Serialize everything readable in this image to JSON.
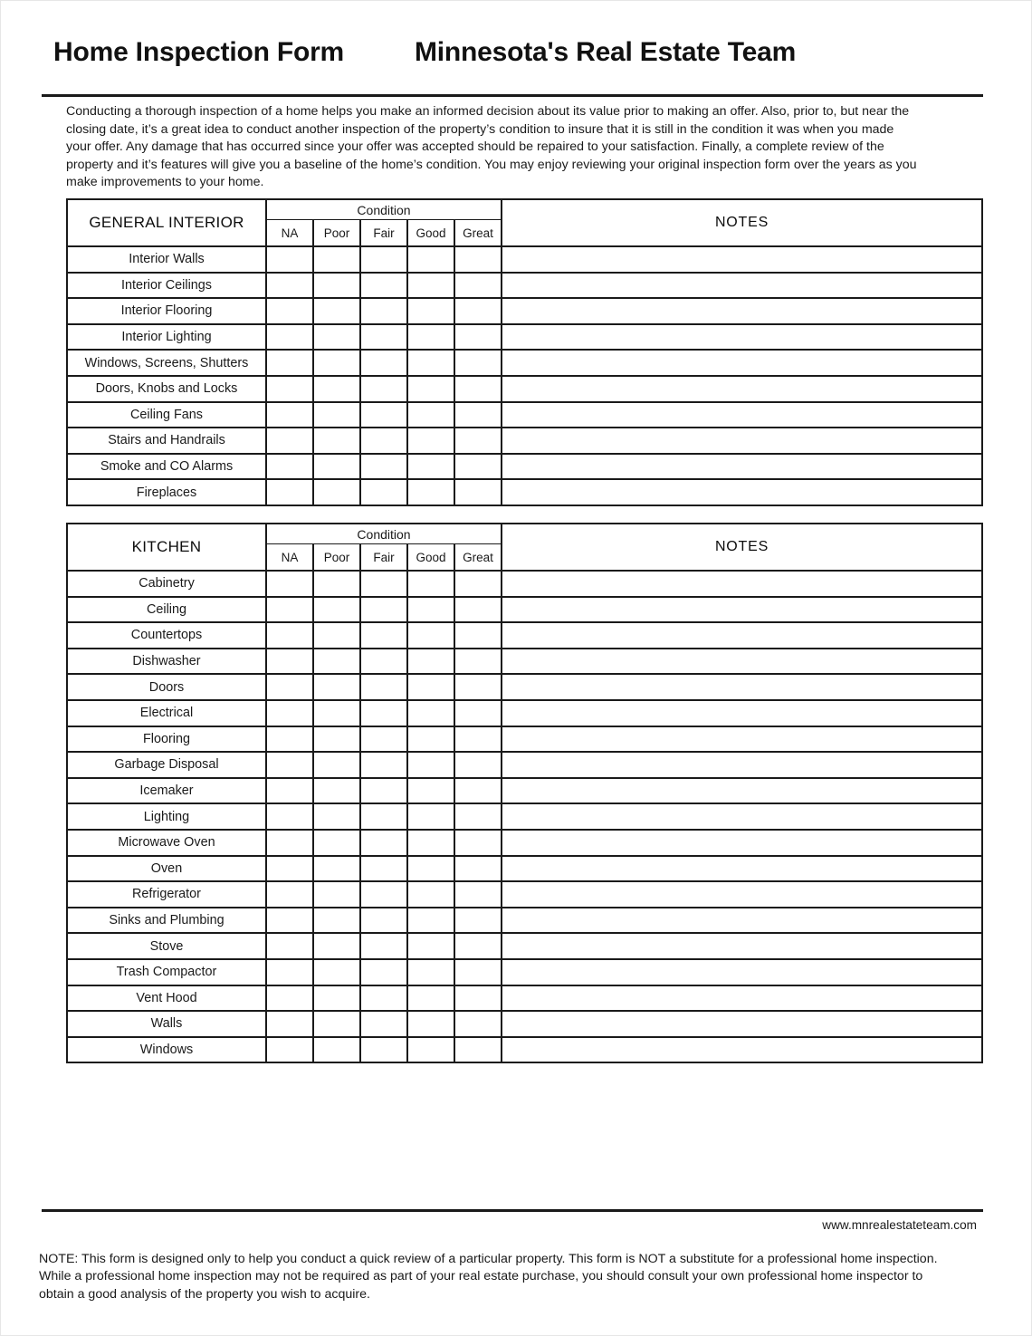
{
  "header": {
    "form_title": "Home Inspection Form",
    "brand_title": "Minnesota's Real Estate Team"
  },
  "intro": {
    "paragraph": "Conducting a thorough inspection of a home helps you make an informed decision about its value prior to making an offer.  Also, prior to, but near the closing date, it’s a great idea to conduct another inspection of the property’s condition to insure that it is still in the condition it was when you made your offer.  Any damage that has occurred since your offer was accepted should be repaired to your satisfaction.  Finally, a complete review of the property and it’s features will give you a baseline of the home’s condition.  You may enjoy reviewing your original inspection form over the years as you make improvements to your home."
  },
  "tables": {
    "condition_label": "Condition",
    "notes_label": "NOTES",
    "condition_columns": [
      "NA",
      "Poor",
      "Fair",
      "Good",
      "Great"
    ],
    "sections": [
      {
        "name": "GENERAL INTERIOR",
        "rows": [
          "Interior Walls",
          "Interior Ceilings",
          "Interior Flooring",
          "Interior Lighting",
          "Windows, Screens, Shutters",
          "Doors, Knobs and Locks",
          "Ceiling Fans",
          "Stairs and Handrails",
          "Smoke and CO Alarms",
          "Fireplaces"
        ]
      },
      {
        "name": "KITCHEN",
        "rows": [
          "Cabinetry",
          "Ceiling",
          "Countertops",
          "Dishwasher",
          "Doors",
          "Electrical",
          "Flooring",
          "Garbage Disposal",
          "Icemaker",
          "Lighting",
          "Microwave Oven",
          "Oven",
          "Refrigerator",
          "Sinks and Plumbing",
          "Stove",
          "Trash Compactor",
          "Vent Hood",
          "Walls",
          "Windows"
        ]
      }
    ]
  },
  "footer": {
    "website": "www.mnrealestateteam.com",
    "note": "NOTE:  This form is designed only to help you conduct a quick review of a particular property.  This form is NOT a substitute for a professional home inspection.  While a professional home inspection may not be required as part of your real estate purchase, you should consult your own professional home inspector to obtain a good analysis of the property you wish to acquire."
  }
}
